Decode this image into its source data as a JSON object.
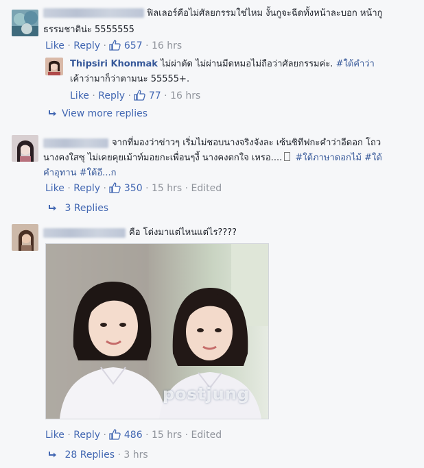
{
  "colors": {
    "link": "#4267b2",
    "meta": "#90949c",
    "text": "#1d2129",
    "background": "#f6f7f9"
  },
  "actions_labels": {
    "like": "Like",
    "reply": "Reply",
    "edited": "Edited"
  },
  "comments": [
    {
      "text_line1": "ฟิลเลอร์คือไม่ศัลยกรรมใช่ไหม งั้นกูจะฉีดทั้งหน้าละบอก หน้ากู",
      "text_line2": "ธรรมชาติน่ะ 5555555",
      "likes": "657",
      "time": "16 hrs",
      "reply": {
        "author": "Thipsiri Khonmak",
        "text_line1": " ไม่ผ่าตัด ไม่ผ่านมีดหมอไม่ถือว่าศัลยกรรมค่ะ.",
        "hashtag1": "#ใต้คำว่า",
        "text_line2": "เค้าว่ามาก็ว่าตามนะ 55555+.",
        "likes": "77",
        "time": "16 hrs"
      },
      "view_more": "View more replies"
    },
    {
      "text_line1": "จากที่มองว่าข่าวๆ เริ่มไม่ชอบนางจริงจังละ เซ้นซิทีฟกะคำว่าอีดอก โถว",
      "text_line2": "นางคงใสซุ ไม่เคยคุยเม้าท์มอยกะเพื่อนๆงี้ นางคงตกใจ เหรอ....",
      "hashtag_a": "#ใต้ภาษาดอกไม้",
      "hashtag_b": "#ใต้",
      "text_line3": "คำอุทาน #ใต้อี...ก",
      "likes": "350",
      "time": "15 hrs",
      "edited": "Edited",
      "replies": "3 Replies"
    },
    {
      "text_line1": "คือ โด่งมาแต่ไหนแต่ไร????",
      "photo_watermark": "postjung",
      "likes": "486",
      "time": "15 hrs",
      "edited": "Edited",
      "replies": "28 Replies",
      "replies_time": "3 hrs"
    }
  ]
}
